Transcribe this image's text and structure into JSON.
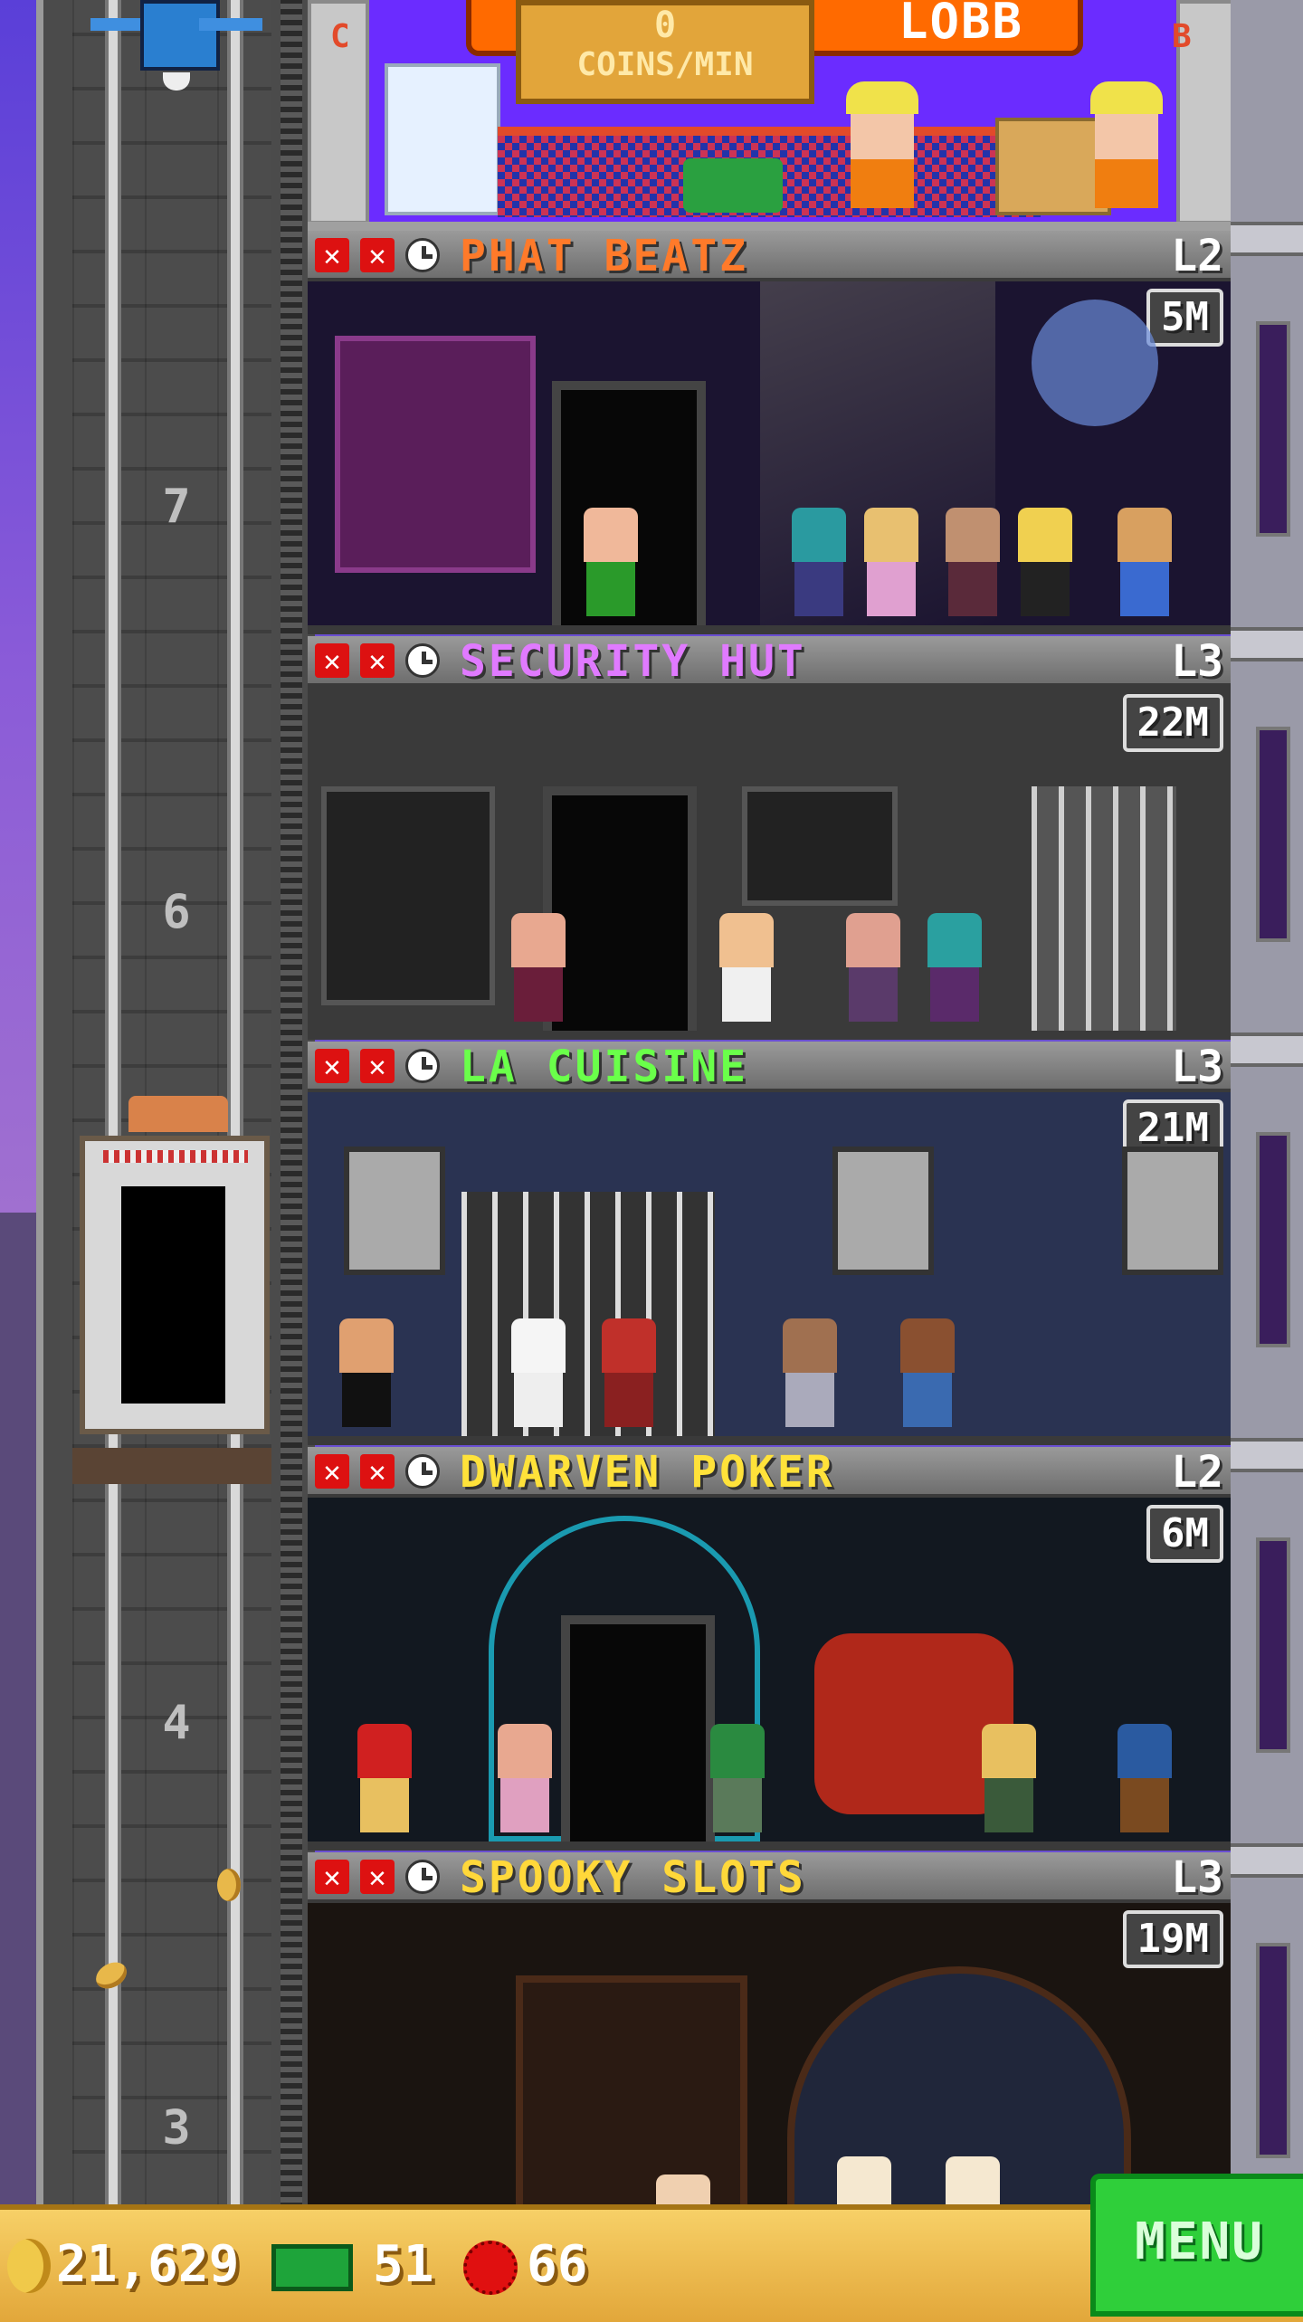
{
  "lobby": {
    "coins_per_min_value": "0",
    "coins_per_min_label": "COINS/MIN",
    "banner_text": "LOBB",
    "wall_letter_left": "C",
    "wall_letter_right": "B"
  },
  "shaft": {
    "floor_numbers": [
      "7",
      "6",
      "4",
      "3"
    ]
  },
  "floors": [
    {
      "name": "PHAT BEATZ",
      "level": "L2",
      "earnings": "5M",
      "name_color": "#ff7a2a",
      "room_color": "#1b1430"
    },
    {
      "name": "SECURITY HUT",
      "level": "L3",
      "earnings": "22M",
      "name_color": "#e07aff",
      "room_color": "#3a3a3a"
    },
    {
      "name": "LA CUISINE",
      "level": "L3",
      "earnings": "21M",
      "name_color": "#6aff4a",
      "room_color": "#2a3352"
    },
    {
      "name": "DWARVEN POKER",
      "level": "L2",
      "earnings": "6M",
      "name_color": "#ffe23a",
      "room_color": "#121820"
    },
    {
      "name": "SPOOKY SLOTS",
      "level": "L3",
      "earnings": "19M",
      "name_color": "#ffd83a",
      "room_color": "#1a1410"
    }
  ],
  "bottom_bar": {
    "coins": "21,629",
    "bux": "51",
    "gems": "66",
    "menu_label": "MENU"
  }
}
